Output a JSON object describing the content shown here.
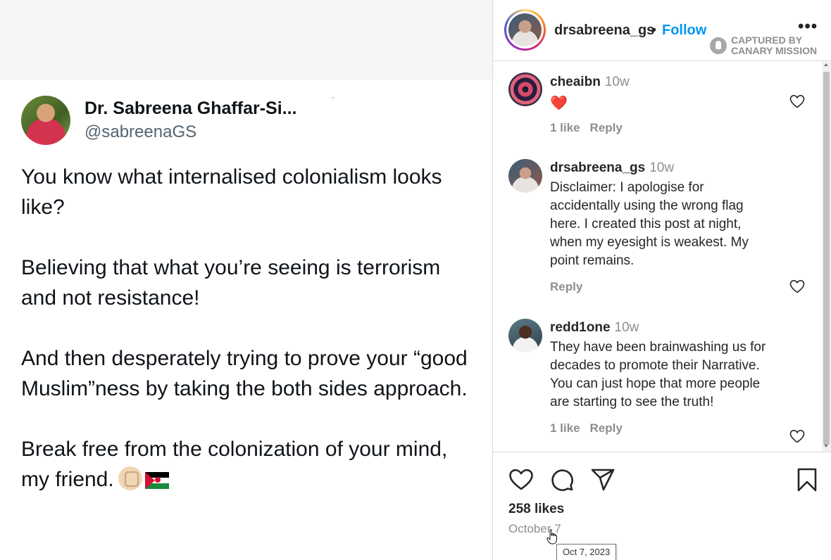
{
  "tweet": {
    "display_name": "Dr. Sabreena Ghaffar-Si...",
    "handle": "@sabreenaGS",
    "paragraphs": [
      "You know what internalised colonialism looks like?",
      "Believing that what you’re seeing is terrorism and not resistance!",
      "And then desperately trying to prove your “good Muslim”ness by taking the both sides approach.",
      "Break free from the colonization of your mind, my friend."
    ]
  },
  "instagram": {
    "header": {
      "username": "drsabreena_gs",
      "separator": "•",
      "follow_label": "Follow",
      "more_label": "•••",
      "watermark": "CAPTURED BY\nCANARY MISSION"
    },
    "comments": [
      {
        "user": "cheaibn",
        "time": "10w",
        "text": "❤️",
        "likes": "1 like",
        "reply": "Reply"
      },
      {
        "user": "drsabreena_gs",
        "time": "10w",
        "text": "Disclaimer: I apologise for accidentally using the wrong flag here. I created this post at night, when my eyesight is weakest. My point remains.",
        "likes": "",
        "reply": "Reply"
      },
      {
        "user": "redd1one",
        "time": "10w",
        "text": "They have been brainwashing us for decades to promote their Narrative. You can just hope that more people are starting to see the truth!",
        "likes": "1 like",
        "reply": "Reply"
      }
    ],
    "likes_count": "258 likes",
    "date": "October 7",
    "tooltip": "Oct 7, 2023"
  },
  "icons": {
    "like": "heart-icon",
    "comment": "comment-bubble-icon",
    "share": "paper-plane-icon",
    "save": "bookmark-icon"
  },
  "colors": {
    "follow": "#0095f6",
    "heart_red": "#ed2d3f",
    "muted": "#8e8e8e"
  }
}
